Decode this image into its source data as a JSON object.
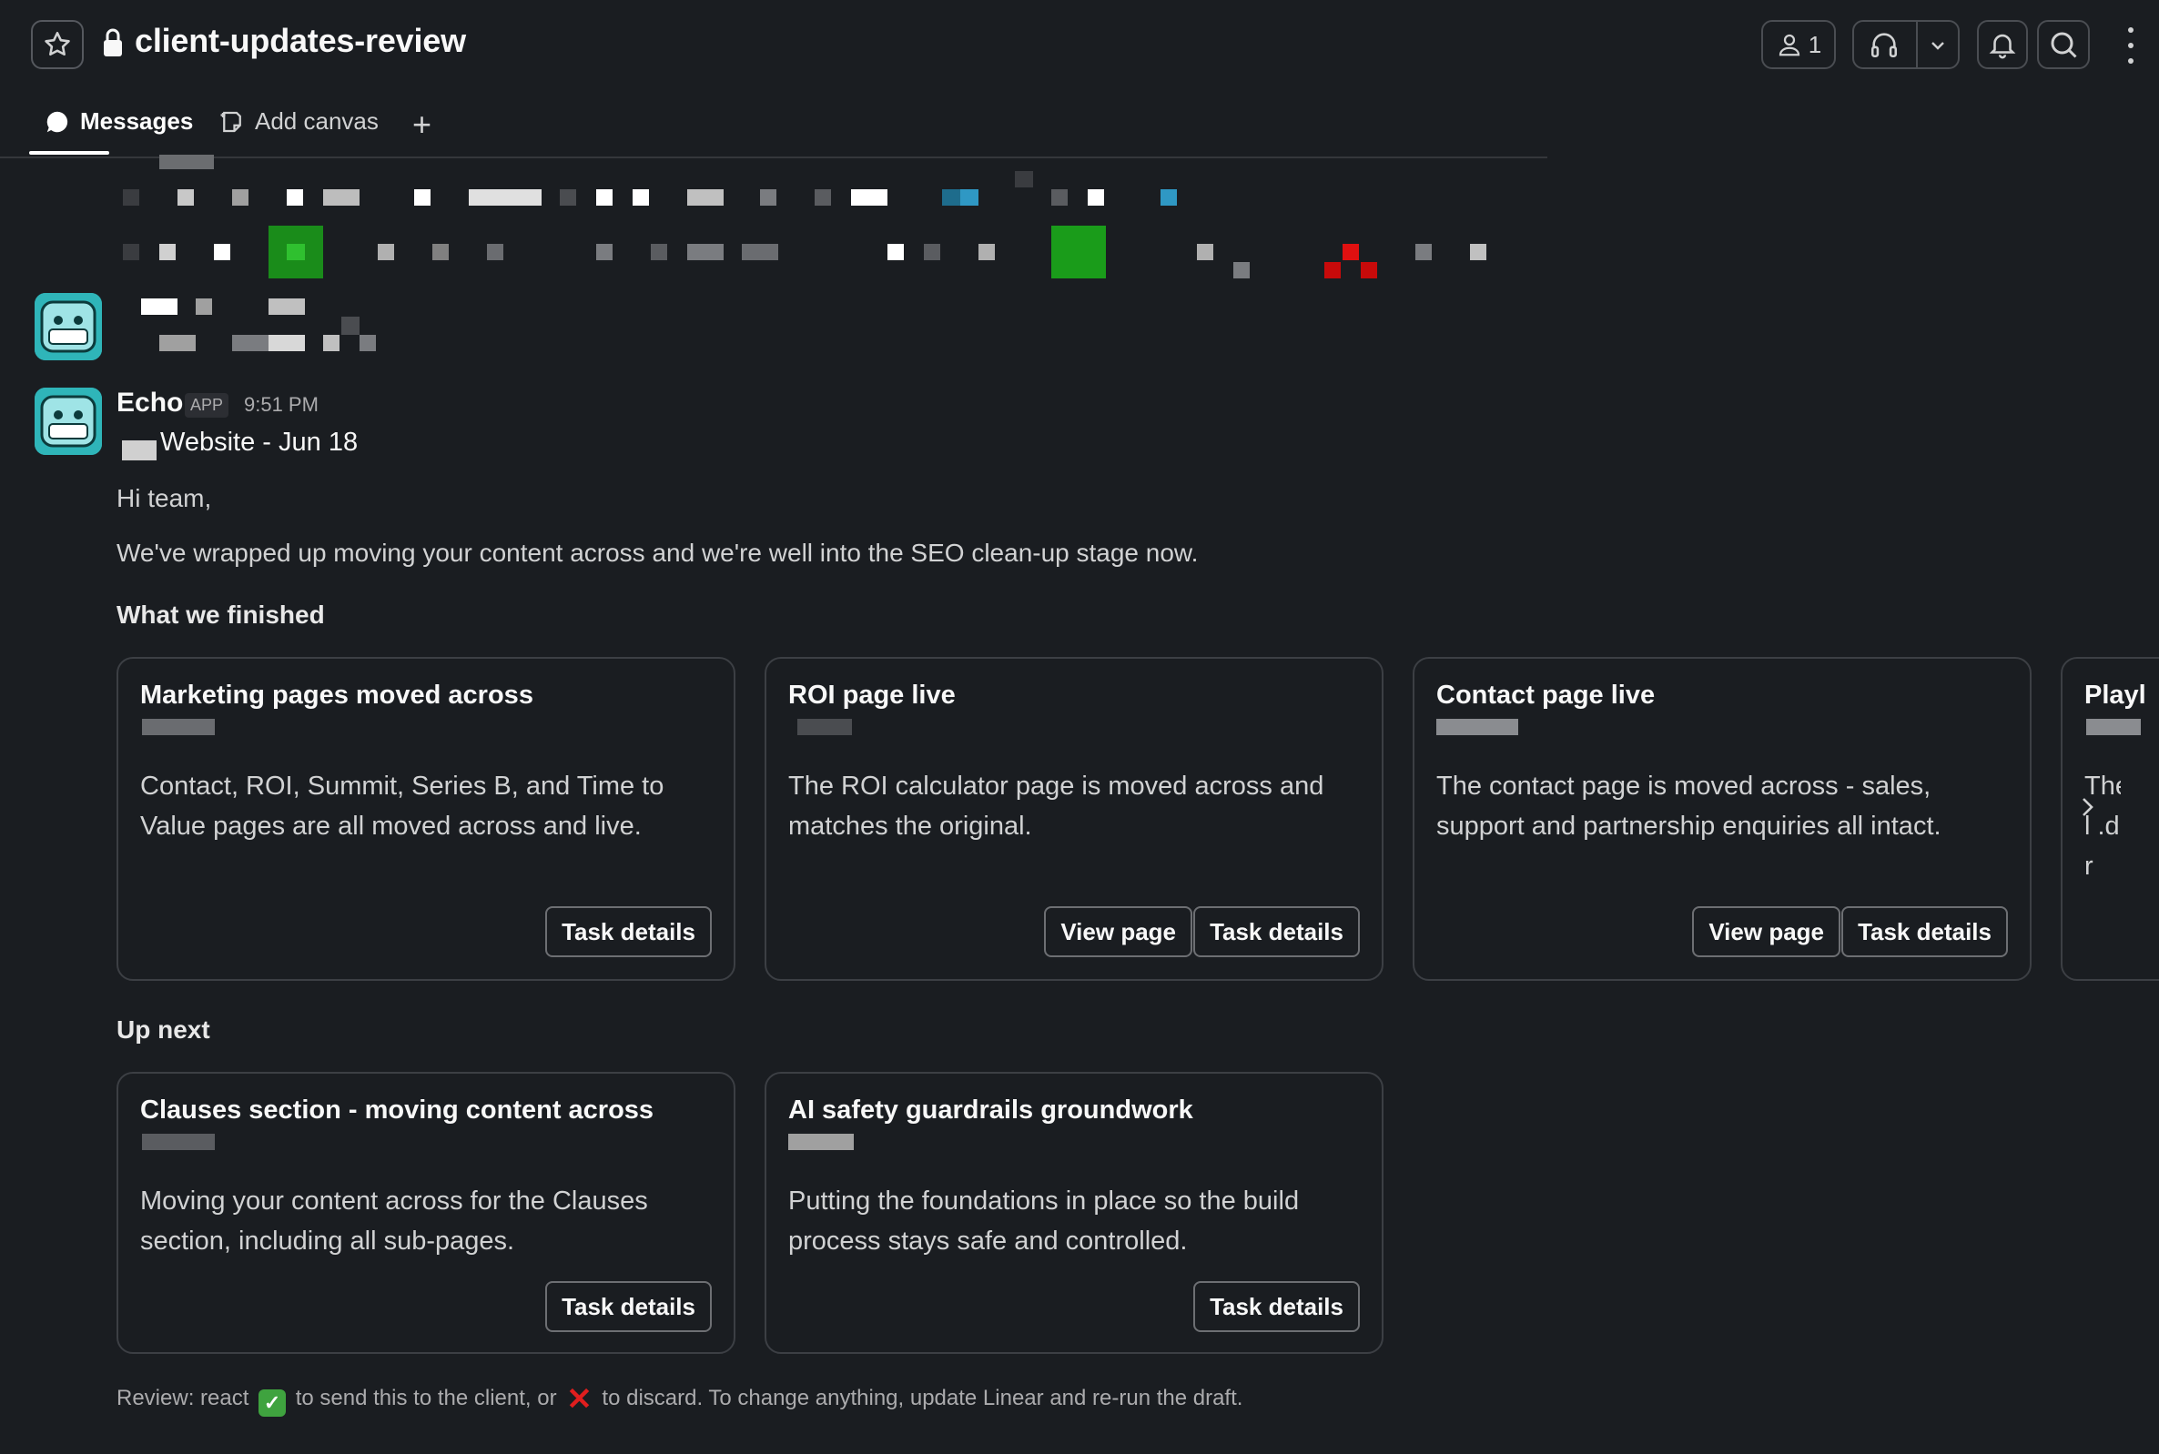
{
  "header": {
    "channel_name": "client-updates-review",
    "member_count": "1"
  },
  "tabs": {
    "messages": "Messages",
    "add_canvas": "Add canvas",
    "plus": "+"
  },
  "message": {
    "sender": "Echo",
    "badge": "APP",
    "time": "9:51 PM",
    "subtitle": "Website - Jun 18",
    "greeting": "Hi team,",
    "intro": "We've wrapped up moving your content across and we're well into the SEO clean-up stage now.",
    "finished_heading": "What we finished",
    "upnext_heading": "Up next",
    "finished_cards": [
      {
        "title": "Marketing pages moved across",
        "body": "Contact, ROI, Summit, Series B, and Time to Value pages are all moved across and live.",
        "task_details": "Task details"
      },
      {
        "title": "ROI page live",
        "body": "The ROI calculator page is moved across and matches the original.",
        "view_page": "View page",
        "task_details": "Task details"
      },
      {
        "title": "Contact page live",
        "body": "The contact page is moved across - sales, support and partnership enquiries all intact.",
        "view_page": "View page",
        "task_details": "Task details"
      },
      {
        "title": "Playl",
        "body": "The l .d r"
      }
    ],
    "upnext_cards": [
      {
        "title": "Clauses section - moving content across",
        "body": "Moving your content across for the Clauses section, including all sub-pages.",
        "task_details": "Task details"
      },
      {
        "title": "AI safety guardrails groundwork",
        "body": "Putting the foundations in place so the build process stays safe and controlled.",
        "task_details": "Task details"
      }
    ],
    "footer": {
      "part1": "Review: react",
      "part2": "to send this to the client, or",
      "part3": "to discard. To change anything, update Linear and re-run the draft."
    }
  },
  "icons": {
    "star": "star-icon",
    "lock": "lock-icon",
    "person": "person-icon",
    "headphones": "headphones-icon",
    "bell": "bell-icon",
    "search": "search-icon",
    "more": "more-vertical-icon",
    "chat": "chat-bubble-icon",
    "canvas": "canvas-icon",
    "chevron_right": "chevron-right-icon"
  },
  "colors": {
    "background": "#1a1d21",
    "avatar": "#2fb5b9",
    "reaction_check": "#3fa33f",
    "reaction_x": "#e01e1e"
  }
}
